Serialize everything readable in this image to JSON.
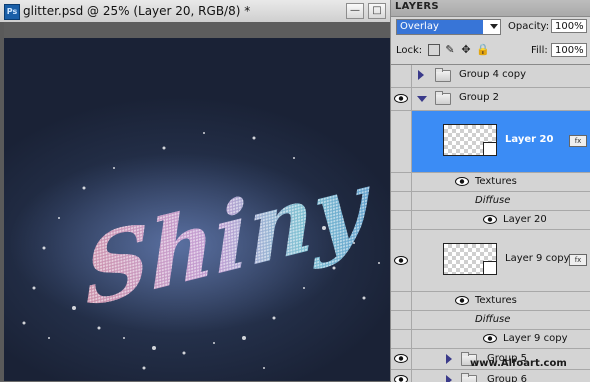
{
  "document": {
    "app_badge": "Ps",
    "title": "glitter.psd @ 25% (Layer 20, RGB/8) *",
    "minimize_label": "—",
    "restore_label": "□",
    "canvas_text": "Shiny"
  },
  "layers_panel": {
    "tab_label": "LAYERS",
    "blend_mode": "Overlay",
    "opacity_label": "Opacity:",
    "opacity_value": "100%",
    "lock_label": "Lock:",
    "fill_label": "Fill:",
    "fill_value": "100%",
    "layers": [
      {
        "name": "Group 4 copy"
      },
      {
        "name": "Group 2"
      },
      {
        "name": "Layer 20"
      },
      {
        "name": "Textures"
      },
      {
        "name": "Diffuse"
      },
      {
        "name": "Layer 20"
      },
      {
        "name": "Layer 9 copy"
      },
      {
        "name": "Textures"
      },
      {
        "name": "Diffuse"
      },
      {
        "name": "Layer 9 copy"
      },
      {
        "name": "Group 5"
      },
      {
        "name": "Group 6"
      }
    ]
  },
  "watermark": "www.Alfoart.com",
  "colors": {
    "selection": "#3b8cf5",
    "canvas_bg": "#24304a",
    "blend_highlight": "#3875d7"
  }
}
